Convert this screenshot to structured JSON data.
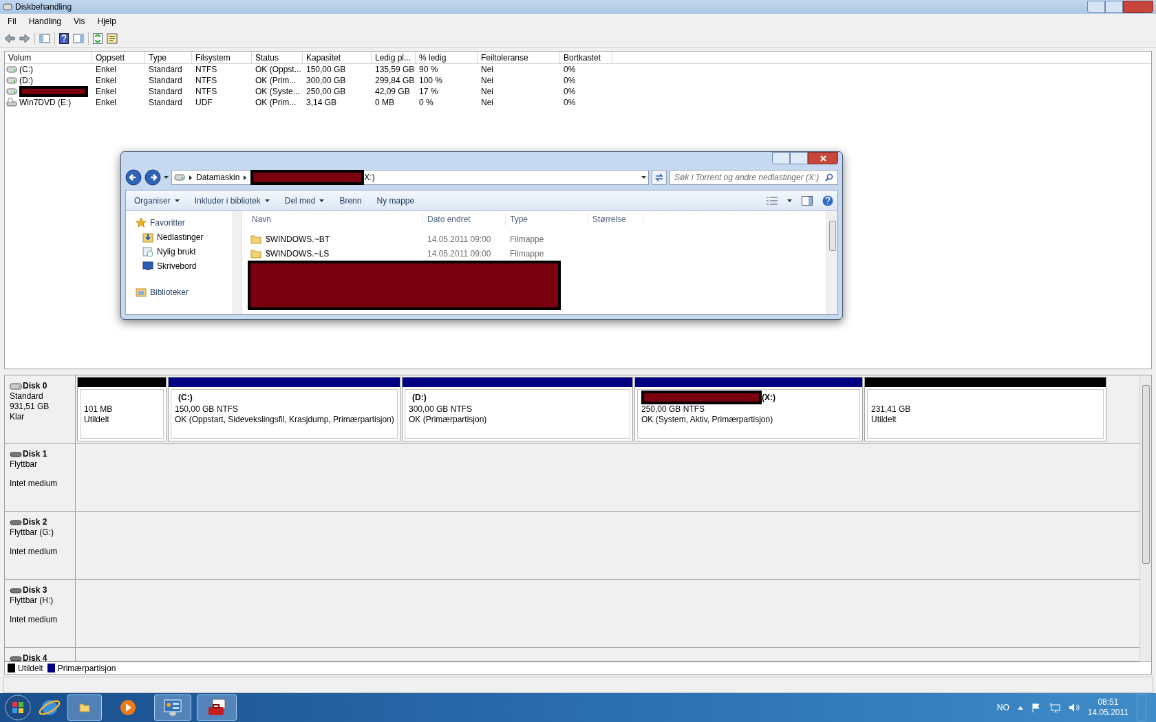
{
  "window": {
    "title": "Diskbehandling"
  },
  "menu": [
    "Fil",
    "Handling",
    "Vis",
    "Hjelp"
  ],
  "volumes": {
    "volume_column": "Volum",
    "columns": [
      "Oppsett",
      "Type",
      "Filsystem",
      "Status",
      "Kapasitet",
      "Ledig pl...",
      "% ledig",
      "Feiltoleranse",
      "Bortkastet"
    ],
    "rows": [
      {
        "kind": "hdd",
        "volume": "(C:)",
        "redacted": false,
        "cells": [
          "Enkel",
          "Standard",
          "NTFS",
          "OK (Oppst...",
          "150,00 GB",
          "135,59 GB",
          "90 %",
          "Nei",
          "0%"
        ]
      },
      {
        "kind": "hdd",
        "volume": "(D:)",
        "redacted": false,
        "cells": [
          "Enkel",
          "Standard",
          "NTFS",
          "OK (Prim...",
          "300,00 GB",
          "299,84 GB",
          "100 %",
          "Nei",
          "0%"
        ]
      },
      {
        "kind": "hdd",
        "redacted": true,
        "cells": [
          "Enkel",
          "Standard",
          "NTFS",
          "OK (Syste...",
          "250,00 GB",
          "42,09 GB",
          "17 %",
          "Nei",
          "0%"
        ]
      },
      {
        "kind": "dvd",
        "volume": "Win7DVD (E:)",
        "redacted": false,
        "cells": [
          "Enkel",
          "Standard",
          "UDF",
          "OK (Prim...",
          "3,14 GB",
          "0 MB",
          "0 %",
          "Nei",
          "0%"
        ]
      }
    ]
  },
  "explorer": {
    "address": {
      "root": "Datamaskin",
      "redacted": true,
      "tail": "X:)"
    },
    "search": {
      "placeholder": "Søk i Torrent og andre nedlastinger (X:)"
    },
    "commands": [
      {
        "label": "Organiser",
        "dropdown": true
      },
      {
        "label": "Inkluder i bibliotek",
        "dropdown": true
      },
      {
        "label": "Del med",
        "dropdown": true
      },
      {
        "label": "Brenn",
        "dropdown": false
      },
      {
        "label": "Ny mappe",
        "dropdown": false
      }
    ],
    "nav": [
      {
        "kind": "star",
        "label": "Favoritter",
        "group": true
      },
      {
        "kind": "download",
        "label": "Nedlastinger",
        "group": false
      },
      {
        "kind": "recent",
        "label": "Nylig brukt",
        "group": false
      },
      {
        "kind": "desktop",
        "label": "Skrivebord",
        "group": false
      },
      {
        "kind": "library",
        "label": "Biblioteker",
        "group": true
      }
    ],
    "columns": [
      "Navn",
      "Dato endret",
      "Type",
      "Størrelse"
    ],
    "files": [
      {
        "name": "$WINDOWS.~BT",
        "date": "14.05.2011 09:00",
        "type": "Filmappe"
      },
      {
        "name": "$WINDOWS.~LS",
        "date": "14.05.2011 09:00",
        "type": "Filmappe"
      }
    ],
    "redacted_rows": true
  },
  "disks": [
    {
      "name": "Disk 0",
      "kind": "basic",
      "type": "Standard",
      "size": "931,51 GB",
      "status": "Klar",
      "partitions": [
        {
          "kind": "unallocated",
          "color": "#000000",
          "lines": [
            "101 MB",
            "Utildelt"
          ]
        },
        {
          "kind": "primary",
          "color": "#000080",
          "label": "(C:)",
          "label_redacted": false,
          "lines": [
            "150,00 GB NTFS",
            "OK (Oppstart, Sidevekslingsfil, Krasjdump, Primærpartisjon)"
          ]
        },
        {
          "kind": "primary",
          "color": "#000080",
          "label": "(D:)",
          "label_redacted": false,
          "lines": [
            "300,00 GB NTFS",
            "OK (Primærpartisjon)"
          ]
        },
        {
          "kind": "primary",
          "color": "#000080",
          "label": "(X:)",
          "label_redacted": true,
          "lines": [
            "250,00 GB NTFS",
            "OK (System, Aktiv, Primærpartisjon)"
          ]
        },
        {
          "kind": "unallocated",
          "color": "#000000",
          "lines": [
            "231,41 GB",
            "Utildelt"
          ]
        }
      ]
    },
    {
      "name": "Disk 1",
      "kind": "removable",
      "type": "Flyttbar",
      "status": "Intet medium"
    },
    {
      "name": "Disk 2",
      "kind": "removable",
      "type": "Flyttbar (G:)",
      "status": "Intet medium"
    },
    {
      "name": "Disk 3",
      "kind": "removable",
      "type": "Flyttbar (H:)",
      "status": "Intet medium"
    },
    {
      "name": "Disk 4",
      "kind": "removable"
    }
  ],
  "legend": [
    {
      "label": "Utildelt",
      "color": "#000000"
    },
    {
      "label": "Primærpartisjon",
      "color": "#000080"
    }
  ],
  "taskbar": {
    "language": "NO",
    "time": "08:51",
    "date": "14.05.2011"
  }
}
